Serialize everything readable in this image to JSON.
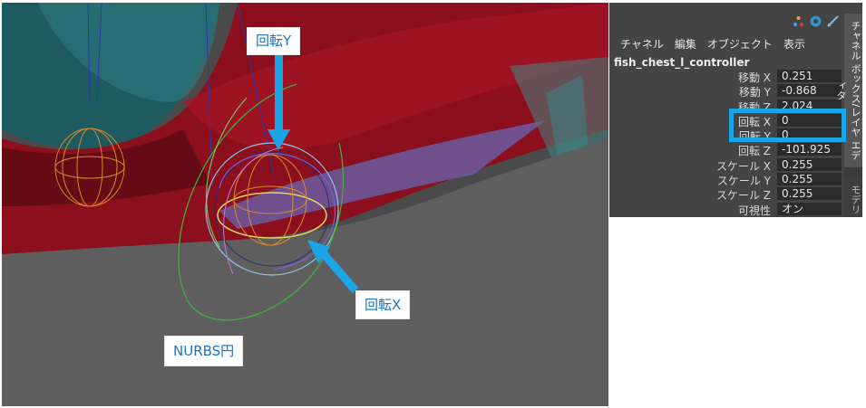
{
  "viewport": {
    "callouts": {
      "rotate_y": "回転Y",
      "rotate_x": "回転X",
      "nurbs": "NURBS円"
    },
    "colors": {
      "arrow": "#1aa6e6",
      "floor": "#5e5e5e",
      "fish_body": "#8a0f1c",
      "fish_teal": "#1f5f66"
    }
  },
  "channel_box": {
    "icons": [
      "transform-icon",
      "channel-icon",
      "pin-icon"
    ],
    "menu": [
      "チャネル",
      "編集",
      "オブジェクト",
      "表示"
    ],
    "node_name": "fish_chest_l_controller",
    "attributes": [
      {
        "label": "移動 X",
        "value": "0.251"
      },
      {
        "label": "移動 Y",
        "value": "-0.868"
      },
      {
        "label": "移動 Z",
        "value": "2.024"
      },
      {
        "label": "回転 X",
        "value": "0"
      },
      {
        "label": "回転 Y",
        "value": "0"
      },
      {
        "label": "回転 Z",
        "value": "-101.925"
      },
      {
        "label": "スケール X",
        "value": "0.255"
      },
      {
        "label": "スケール Y",
        "value": "0.255"
      },
      {
        "label": "スケール Z",
        "value": "0.255"
      },
      {
        "label": "可視性",
        "value": "オン"
      }
    ],
    "side_tabs": {
      "channel": "チャネル ボックス/レイヤ エディタ",
      "modeling": "モデリ"
    },
    "highlight_color": "#1aa6e6"
  }
}
